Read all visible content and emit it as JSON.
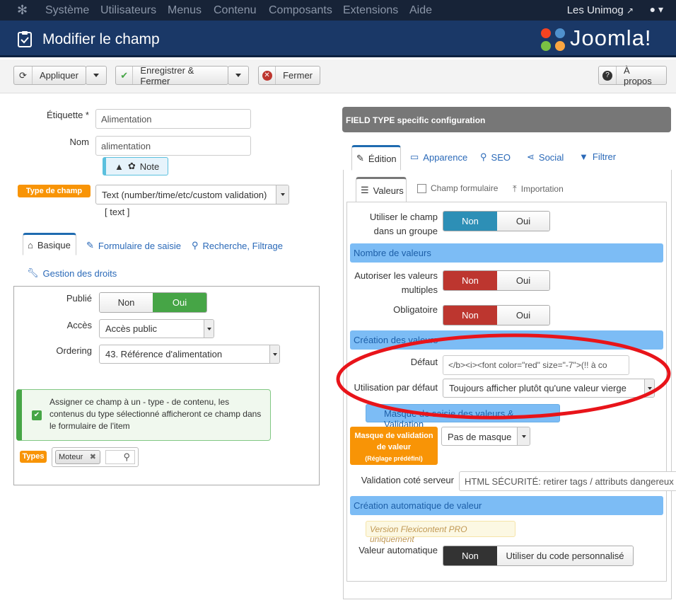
{
  "topnav": {
    "menu": [
      "Système",
      "Utilisateurs",
      "Menus",
      "Contenu",
      "Composants",
      "Extensions",
      "Aide"
    ],
    "site": "Les Unimog",
    "site_icon": "external-link-icon",
    "user_icon": "user-icon"
  },
  "header": {
    "title": "Modifier le champ",
    "logo_text": "Joomla!"
  },
  "toolbar": {
    "apply": "Appliquer",
    "save_close": "Enregistrer & Fermer",
    "close": "Fermer",
    "about": "À propos"
  },
  "left": {
    "label_label": "Étiquette *",
    "label_value": "Alimentation",
    "name_label": "Nom",
    "name_value": "alimentation",
    "note_button": "Note",
    "field_type_badge": "Type de champ",
    "field_type_value": "Text (number/time/etc/custom validation)",
    "field_type_code": "[ text ]",
    "tabs": {
      "basic": "Basique",
      "form": "Formulaire de saisie",
      "search": "Recherche, Filtrage",
      "rights": "Gestion des droits"
    },
    "published_label": "Publié",
    "published_no": "Non",
    "published_yes": "Oui",
    "access_label": "Accès",
    "access_value": "Accès public",
    "ordering_label": "Ordering",
    "ordering_value": "43. Référence d'alimentation",
    "assign_text": "Assigner ce champ à un - type - de contenu, les contenus du type sélectionné afficheront ce champ dans le formulaire de l'item",
    "types_badge": "Types",
    "types_tag": "Moteur"
  },
  "right": {
    "panel_title": "FIELD TYPE specific configuration",
    "tabs": [
      "Édition",
      "Apparence",
      "SEO",
      "Social",
      "Filtrer"
    ],
    "subtabs": [
      "Valeurs",
      "Champ formulaire",
      "Importation"
    ],
    "use_in_group_label": "Utiliser le champ dans un groupe",
    "no": "Non",
    "yes": "Oui",
    "section_count": "Nombre de valeurs",
    "allow_multiple_label": "Autoriser les valeurs multiples",
    "required_label": "Obligatoire",
    "section_creation": "Création des valeurs",
    "default_label": "Défaut",
    "default_value": "</b><i><font color=\"red\" size=\"-7\">(!! à co",
    "default_usage_label": "Utilisation par défaut",
    "default_usage_value": "Toujours afficher plutôt qu'une valeur vierge",
    "section_mask": "Masque de saisie des valeurs & Validation",
    "validation_mask_badge": "Masque de validation de valeur",
    "validation_mask_sub": "(Réglage prédéfini)",
    "validation_mask_value": "Pas de masque",
    "server_validation_label": "Validation coté serveur",
    "server_validation_value": "HTML SÉCURITÉ: retirer tags / attributs dangereux",
    "section_auto": "Création automatique de valeur",
    "pro_notice": "Version Flexicontent PRO uniquement",
    "auto_value_label": "Valeur automatique",
    "auto_value_custom": "Utiliser du code personnalisé"
  },
  "colors": {
    "topnav": "#172337",
    "header": "#1a3867",
    "green": "#46a546",
    "red": "#bd362f",
    "blue": "#2d8fb6",
    "orange": "#f89406",
    "highlight_ellipse": "#e8141a"
  }
}
